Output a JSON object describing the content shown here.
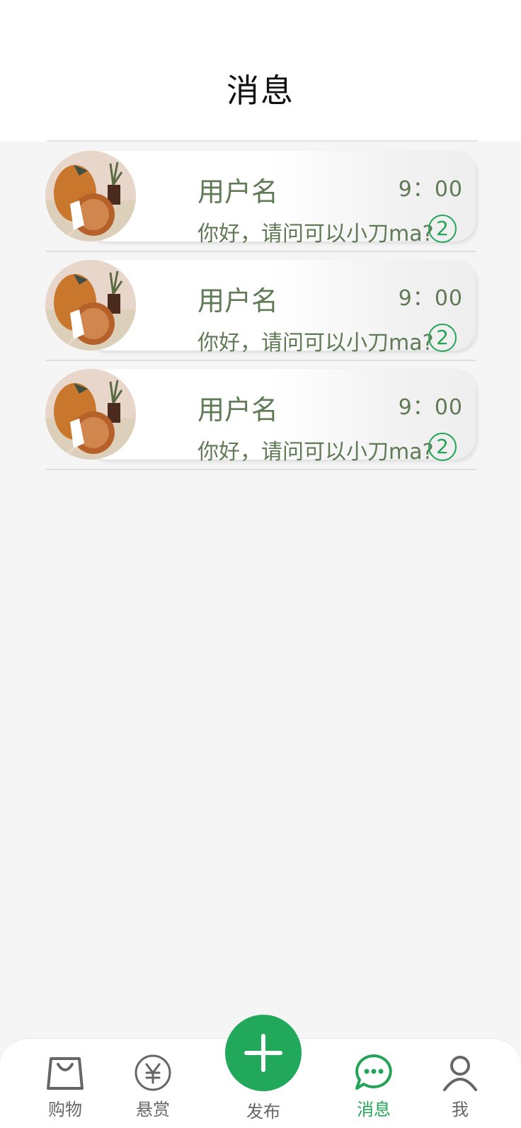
{
  "header": {
    "title": "消息"
  },
  "messages": [
    {
      "username": "用户名",
      "time": "9：00",
      "preview": "你好，请问可以小刀ma?",
      "unread": "2"
    },
    {
      "username": "用户名",
      "time": "9：00",
      "preview": "你好，请问可以小刀ma?",
      "unread": "2"
    },
    {
      "username": "用户名",
      "time": "9：00",
      "preview": "你好，请问可以小刀ma?",
      "unread": "2"
    }
  ],
  "tabbar": {
    "shop": "购物",
    "reward": "悬赏",
    "publish": "发布",
    "messages": "消息",
    "me": "我"
  },
  "colors": {
    "accent": "#23a457",
    "text_green": "#5f7a55"
  }
}
